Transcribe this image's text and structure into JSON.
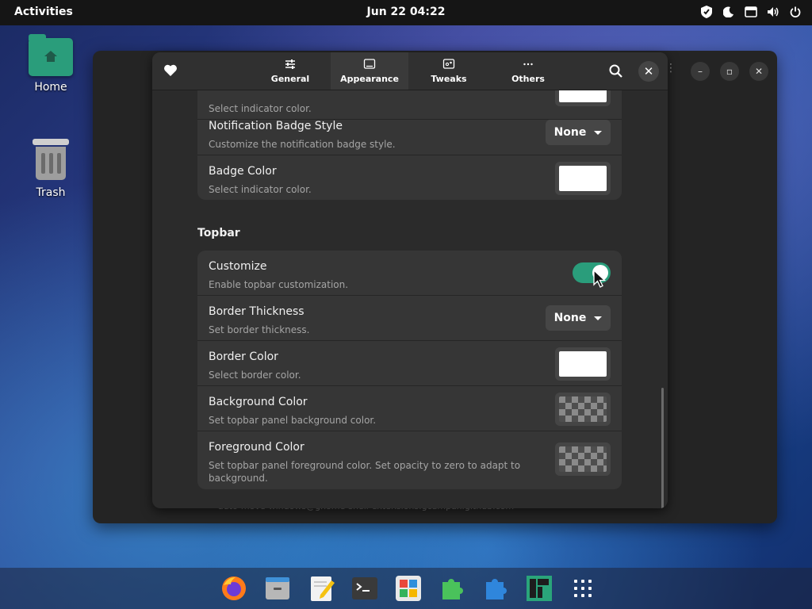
{
  "topbar": {
    "activities": "Activities",
    "clock": "Jun 22  04:22",
    "tray_icons": [
      "shield-icon",
      "moon-icon",
      "screenshot-icon",
      "volume-icon",
      "power-icon"
    ]
  },
  "desktop": {
    "home_label": "Home",
    "trash_label": "Trash"
  },
  "behind_window": {
    "partial_text": "auto-move-windows@gnome-shell-extensions.gcampax.github.com"
  },
  "dialog": {
    "tabs": [
      {
        "label": "General",
        "icon": "sliders-icon"
      },
      {
        "label": "Appearance",
        "icon": "display-icon",
        "active": true
      },
      {
        "label": "Tweaks",
        "icon": "tweaks-icon"
      },
      {
        "label": "Others",
        "icon": "more-icon"
      }
    ],
    "first_group": {
      "partial_row_sub": "Select indicator color.",
      "rows": [
        {
          "title": "Notification Badge Style",
          "sub": "Customize the notification badge style.",
          "value": "None"
        },
        {
          "title": "Badge Color",
          "sub": "Select indicator color."
        }
      ]
    },
    "section_topbar": "Topbar",
    "topbar_rows": [
      {
        "title": "Customize",
        "sub": "Enable topbar customization.",
        "toggle": true
      },
      {
        "title": "Border Thickness",
        "sub": "Set border thickness.",
        "value": "None"
      },
      {
        "title": "Border Color",
        "sub": "Select border color."
      },
      {
        "title": "Background Color",
        "sub": "Set topbar panel background color."
      },
      {
        "title": "Foreground Color",
        "sub": "Set topbar panel foreground color. Set opacity to zero to adapt to background."
      }
    ]
  },
  "colors": {
    "accent": "#2a9d7b",
    "window_bg": "#2b2b2b",
    "row_bg": "#363636"
  },
  "dock": [
    "firefox-icon",
    "files-icon",
    "text-editor-icon",
    "terminal-icon",
    "software-icon",
    "extensions-icon",
    "extension-manager-icon",
    "manjaro-icon",
    "app-grid-icon"
  ]
}
